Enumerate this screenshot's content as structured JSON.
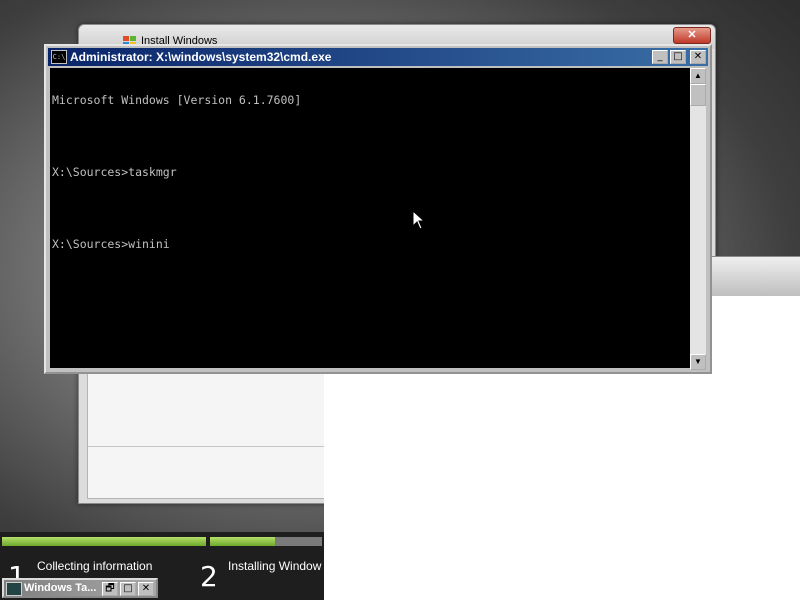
{
  "install_window": {
    "title": "Install Windows",
    "close_label": "✕"
  },
  "cmd_window": {
    "title": "Administrator: X:\\windows\\system32\\cmd.exe",
    "icon_label": "C:\\",
    "minimize_label": "_",
    "maximize_label": "□",
    "close_label": "✕",
    "lines": [
      "Microsoft Windows [Version 6.1.7600]",
      "",
      "X:\\Sources>taskmgr",
      "",
      "X:\\Sources>winini"
    ],
    "scroll_up": "▲",
    "scroll_down": "▼"
  },
  "progress": {
    "steps": [
      {
        "number": "1",
        "label": "Collecting information",
        "progress": 1.0
      },
      {
        "number": "2",
        "label": "Installing Window",
        "progress": 0.58
      }
    ]
  },
  "taskmgr_minimized": {
    "title": "Windows Ta...",
    "restore_label": "🗗",
    "maximize_label": "□",
    "close_label": "✕"
  },
  "colors": {
    "console_bg": "#000000",
    "console_text": "#c0c0c0",
    "titlebar_active": "#0a246a",
    "progress_green": "#7ab83a"
  }
}
